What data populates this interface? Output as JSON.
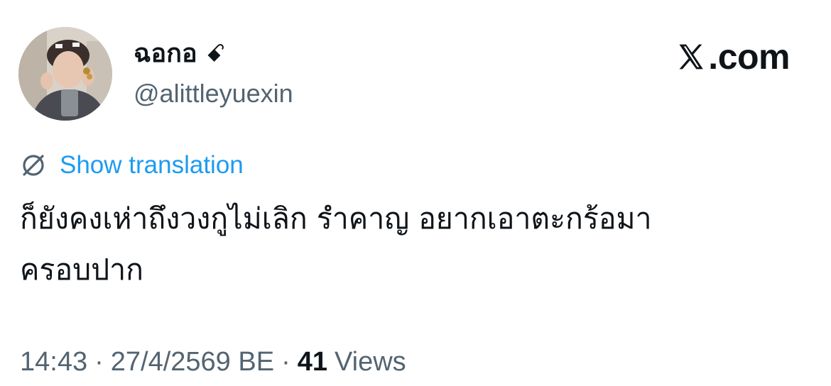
{
  "author": {
    "display_name": "ฉอกอ ␓",
    "display_name_text": "ฉอกอ",
    "display_name_emoji": "ꗃ",
    "handle": "@alittleyuexin",
    "avatar_icon": "profile-photo"
  },
  "brand": {
    "logo_icon": "x-logo-icon",
    "domain_text": ".com"
  },
  "translation": {
    "icon": "globe-icon",
    "label": "Show translation",
    "color": "#1d9bf0"
  },
  "tweet": {
    "text": "ก็ยังคงเห่าถึงวงกูไม่เลิก รำคาญ อยากเอาตะกร้อมา\nครอบปาก"
  },
  "meta": {
    "time": "14:43",
    "separator": "·",
    "date": "27/4/2569 BE",
    "views_count": "41",
    "views_label": "Views"
  },
  "colors": {
    "text_primary": "#0f1419",
    "text_secondary": "#536471",
    "accent": "#1d9bf0"
  }
}
